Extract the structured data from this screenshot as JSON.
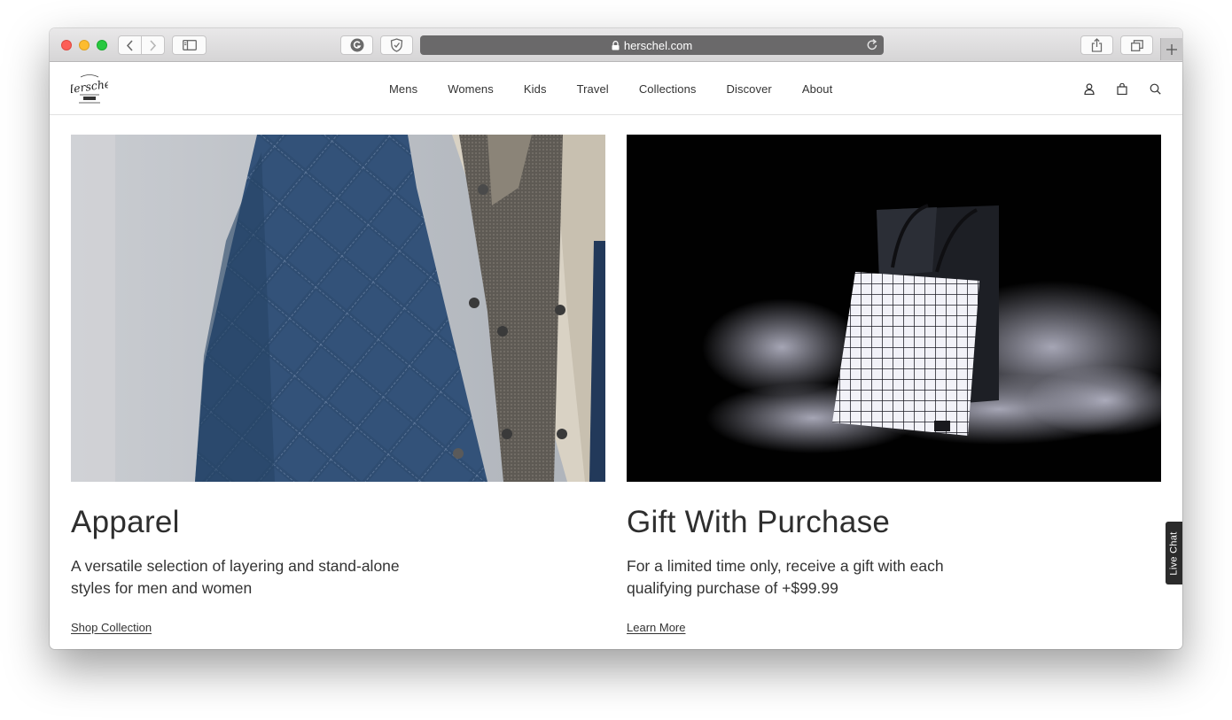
{
  "browser": {
    "url": "herschel.com",
    "icons": {
      "back": "chevron-left-icon",
      "forward": "chevron-right-icon",
      "sidebar": "sidebar-icon",
      "extension_1": "grammar-extension-icon",
      "extension_2": "shield-extension-icon",
      "lock": "lock-icon",
      "reload": "reload-icon",
      "share": "share-icon",
      "tabs": "tabs-overview-icon",
      "new_tab": "plus-icon"
    }
  },
  "site": {
    "logo_alt": "Herschel",
    "logo_small_text": [
      "SUPPLY CO."
    ],
    "nav": [
      "Mens",
      "Womens",
      "Kids",
      "Travel",
      "Collections",
      "Discover",
      "About"
    ],
    "header_icons": [
      "account-icon",
      "bag-icon",
      "search-icon"
    ]
  },
  "cards": [
    {
      "title": "Apparel",
      "description": "A versatile selection of layering and stand-alone styles for men and women",
      "link": "Shop Collection",
      "image": "navy-quilted-jacket-photo"
    },
    {
      "title": "Gift With Purchase",
      "description": "For a limited time only, receive a gift with each qualifying purchase of +$99.99",
      "link": "Learn More",
      "image": "reflective-grid-tote-bag-photo"
    }
  ],
  "live_chat": "Live Chat",
  "colors": {
    "text": "#333333",
    "address_bar": "#6a696a",
    "live_chat_bg": "#2b2b2b"
  }
}
